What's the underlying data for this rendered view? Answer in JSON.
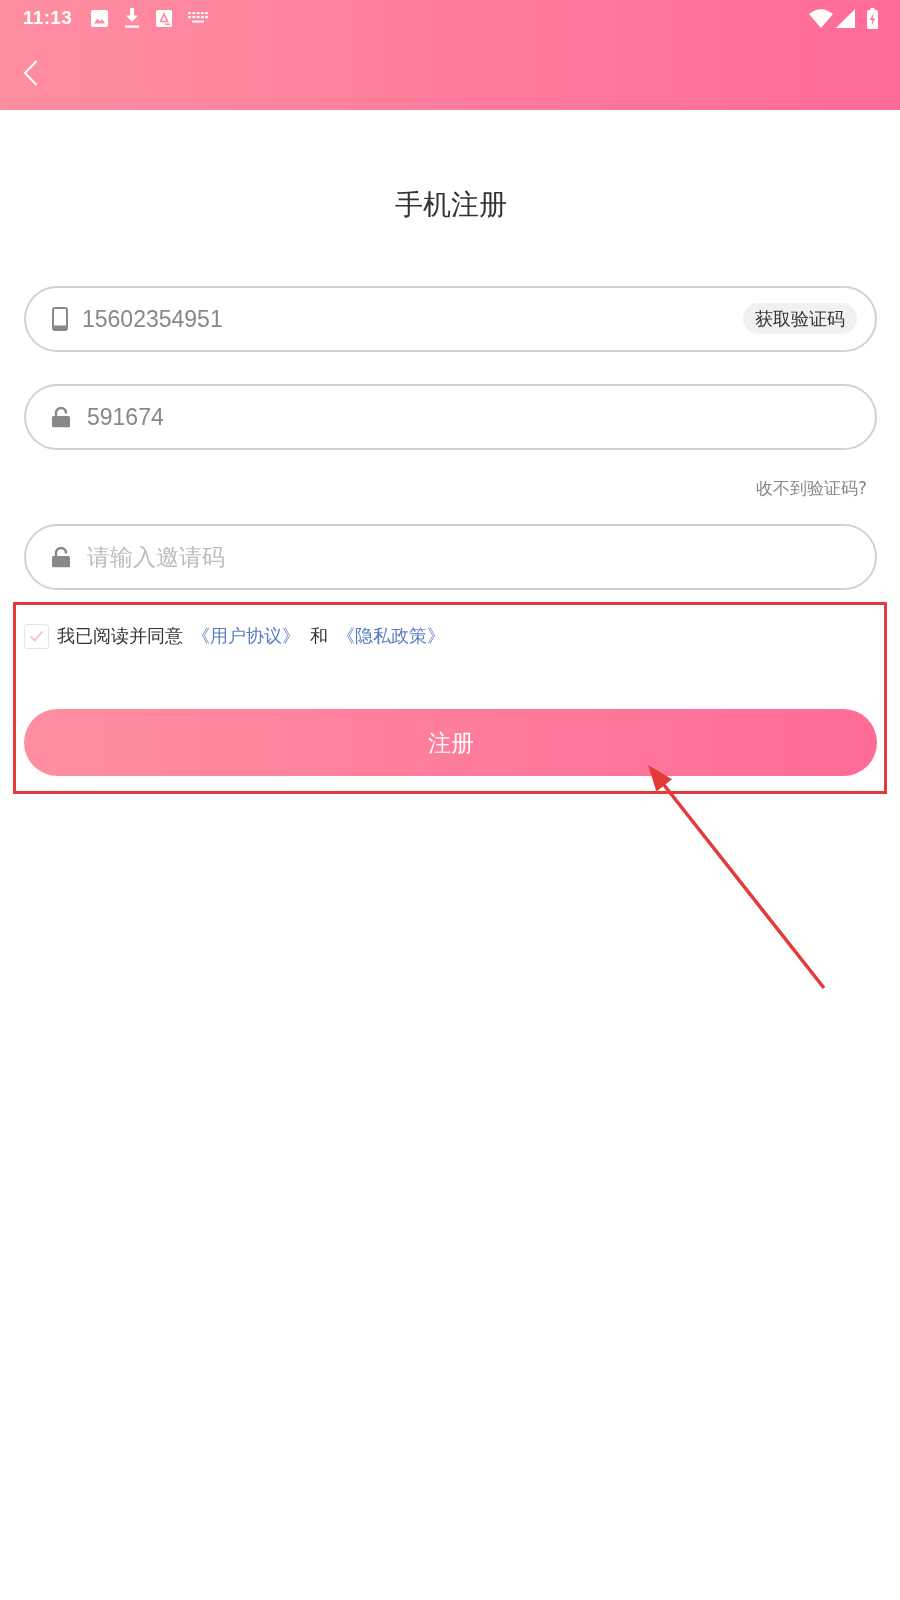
{
  "status_bar": {
    "time": "11:13"
  },
  "title": "手机注册",
  "form": [
    {
      "kind": "phone",
      "value": "15602354951",
      "action": "获取验证码"
    },
    {
      "kind": "code",
      "value": "591674"
    },
    {
      "kind": "link",
      "text": "收不到验证码?"
    },
    {
      "kind": "invite",
      "placeholder": "请输入邀请码"
    }
  ],
  "agreement": {
    "checked": true,
    "parts": [
      {
        "kind": "text",
        "text": "我已阅读并同意"
      },
      {
        "kind": "link",
        "text": "《用户协议》"
      },
      {
        "kind": "text",
        "text": "和"
      },
      {
        "kind": "link",
        "text": "《隐私政策》"
      }
    ]
  },
  "register_button": "注册",
  "annotations": {
    "highlight_box": true,
    "arrow": true
  }
}
